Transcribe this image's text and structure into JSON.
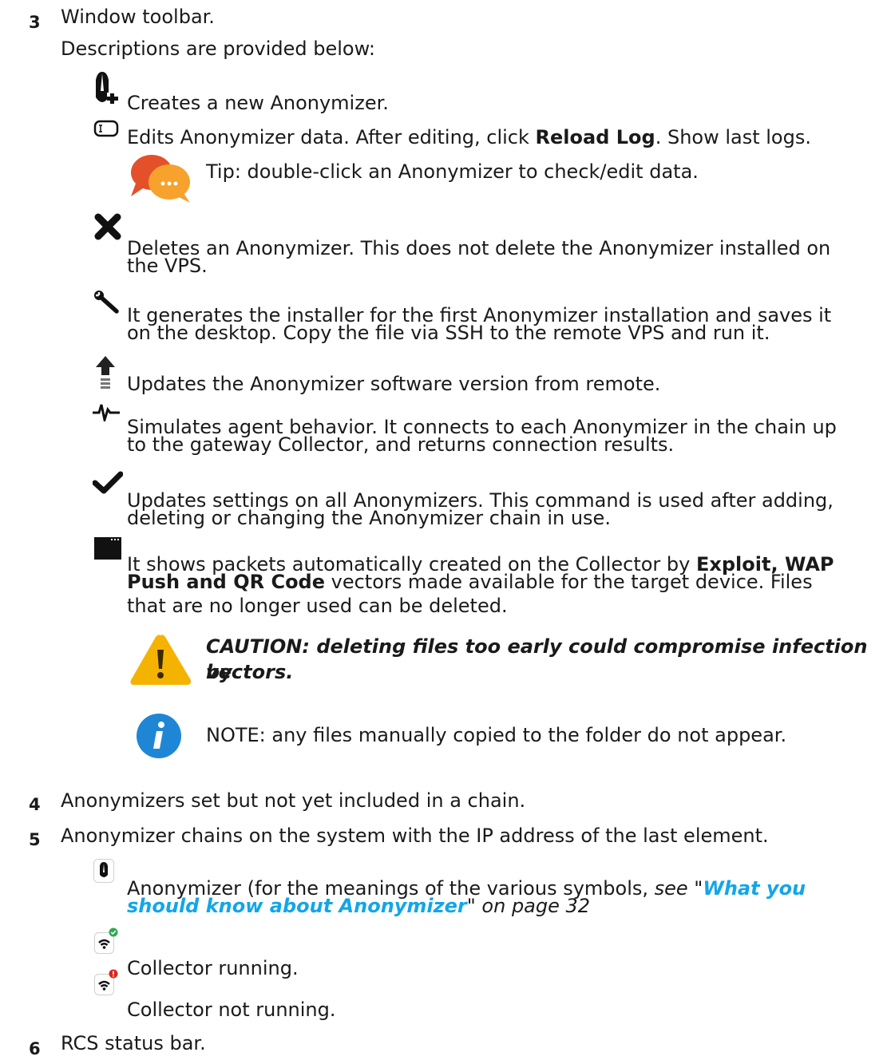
{
  "item3": {
    "number": "3",
    "title": "Window toolbar.",
    "intro": "Descriptions are provided below:",
    "tools": [
      {
        "icon": "add-anonymizer-icon",
        "text": "Creates a new Anonymizer."
      },
      {
        "icon": "edit-icon",
        "text_pre": "Edits Anonymizer data. After editing, click ",
        "text_bold": "Reload Log",
        "text_post": ". Show last logs."
      },
      {
        "icon": "delete-icon",
        "line1": "Deletes an Anonymizer. This does not delete the Anonymizer installed on",
        "line2": "the VPS."
      },
      {
        "icon": "wrench-icon",
        "line1": "It generates the installer for the first Anonymizer installation and saves it",
        "line2": "on the desktop. Copy the file via SSH to the remote VPS and run it."
      },
      {
        "icon": "upload-icon",
        "text": "Updates the Anonymizer software version from remote."
      },
      {
        "icon": "pulse-icon",
        "line1": "Simulates agent behavior. It connects to each Anonymizer in the chain up",
        "line2": "to the gateway Collector, and returns connection results."
      },
      {
        "icon": "check-icon",
        "line1": "Updates settings on all Anonymizers. This command is used after adding,",
        "line2": "deleting or changing the Anonymizer chain in use."
      },
      {
        "icon": "window-icon",
        "line1_pre": "It shows packets automatically created on the Collector by ",
        "line1_bold": "Exploit, WAP",
        "line2_bold": "Push and QR Code",
        "line2_post": " vectors made available for the target device. Files",
        "line3": "that are no longer used can be deleted."
      }
    ],
    "tip": "Tip: double-click an Anonymizer to check/edit data.",
    "caution_line1": "CAUTION: deleting files too early could compromise infection by",
    "caution_line2": "vectors.",
    "note": "NOTE: any files manually copied to the folder do not appear."
  },
  "item4": {
    "number": "4",
    "text": "Anonymizers set but not yet included in a chain."
  },
  "item5": {
    "number": "5",
    "text": "Anonymizer chains on the system with the IP address of the last element.",
    "anonymizer_line1_pre": "Anonymizer (for the meanings of the various symbols, ",
    "anonymizer_see": "see \"",
    "anonymizer_link1": "What you",
    "anonymizer_link2": "should know about Anonymizer",
    "anonymizer_line2_post": "\" on page 32",
    "collector_running": "Collector running.",
    "collector_not_running": "Collector not running."
  },
  "item6": {
    "number": "6",
    "text": "RCS status bar."
  }
}
